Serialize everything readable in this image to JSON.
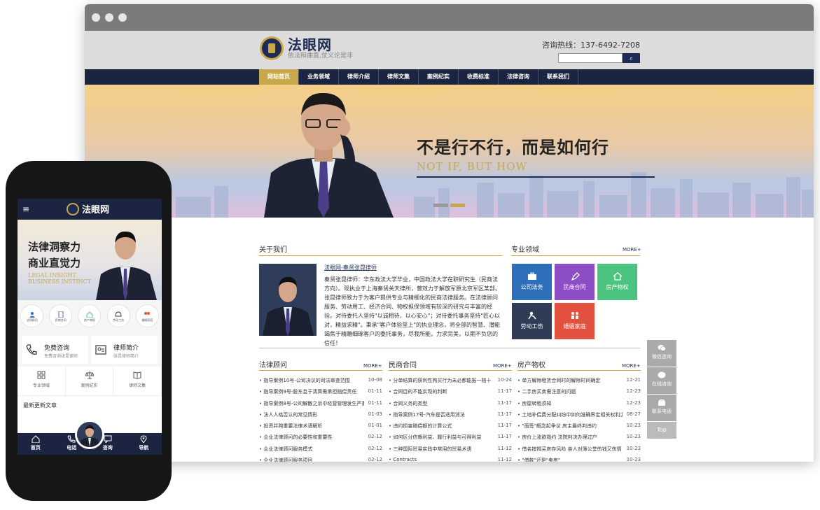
{
  "site": {
    "name": "法眼网",
    "slogan": "依法辩曲直,仗义论是非",
    "hotline": "咨询热线：137-6492-7208",
    "search_button": "⌕",
    "nav": [
      "网站首页",
      "业务领域",
      "律师介绍",
      "律师文集",
      "案例纪实",
      "收费标准",
      "法律咨询",
      "联系我们"
    ]
  },
  "banner": {
    "title": "不是行不行，而是如何行",
    "subtitle": "NOT IF, BUT HOW"
  },
  "about": {
    "title": "关于我们",
    "link": "法眼网-秦贤张昆律师",
    "text": "秦贤张昆律师：华东政法大学毕业，中国政法大学在职研究生（民商法方向）。现执业于上海秦贤关天律所，曾效力于解放军原北京军区某部。张昆律师致力于为客户提供专业与精细化的民商法律服务。在法律顾问服务、劳动用工、经济合同、物权担保领域有较深的研究与丰富的经验。对待委托人坚持\"以诚相待，以心安心\"；对待委托事务坚持\"匠心以对，精益求精\"。秉承\"客户体验至上\"的执业理念，将全部的智慧、潜能竭焦于精雕细琢客户的委托事务，尽我所能，力求完美，以期不负您的信任！"
  },
  "practice": {
    "title": "专业领域",
    "more": "MORE+",
    "tiles": [
      {
        "label": "公司法务",
        "color": "#2d6fb8"
      },
      {
        "label": "民商合同",
        "color": "#8d4dc4"
      },
      {
        "label": "房产物权",
        "color": "#4cc47f"
      },
      {
        "label": "劳动工伤",
        "color": "#2e3d55"
      },
      {
        "label": "婚姻家庭",
        "color": "#e2503f"
      }
    ]
  },
  "columns": [
    {
      "title": "法律顾问",
      "more": "MORE+",
      "items": [
        {
          "t": "指导案例10号-公司决议的司法审查范围",
          "d": "10-08"
        },
        {
          "t": "指导案例9号-股东怠于清算需承担赔偿责任",
          "d": "01-11"
        },
        {
          "t": "指导案例8号-公司解散之诉中经营管理发生严重困难",
          "d": "01-11"
        },
        {
          "t": "法人人格否认的常见情形",
          "d": "01-03"
        },
        {
          "t": "投资并购重要法律术语解析",
          "d": "01-01"
        },
        {
          "t": "企业法律顾问的必要性和重要性",
          "d": "02-12"
        },
        {
          "t": "企业法律顾问服务模式",
          "d": "02-12"
        },
        {
          "t": "企业法律顾问服务项目",
          "d": "02-12"
        }
      ]
    },
    {
      "title": "民商合同",
      "more": "MORE+",
      "items": [
        {
          "t": "分单结算的获利性购买行为未必都能报一赔十",
          "d": "10-24"
        },
        {
          "t": "合同目的不能实现的判断",
          "d": "11-17"
        },
        {
          "t": "合同义务的类型",
          "d": "11-17"
        },
        {
          "t": "指导案例17号-汽车是否适用消法",
          "d": "11-17"
        },
        {
          "t": "违约损害赔偿额的计算公式",
          "d": "11-17"
        },
        {
          "t": "如何区分信赖利益、履行利益与可得利益",
          "d": "11-17"
        },
        {
          "t": "三种国际贸易实践中常用的贸易术语",
          "d": "11-12"
        },
        {
          "t": "Contracts",
          "d": "11-12"
        }
      ]
    },
    {
      "title": "房产物权",
      "more": "MORE+",
      "items": [
        {
          "t": "单方解除租赁合同时的解除时间确定",
          "d": "12-21"
        },
        {
          "t": "二手房买卖需注意的问题",
          "d": "12-23"
        },
        {
          "t": "房屋转租须知",
          "d": "12-23"
        },
        {
          "t": "土地补偿费分配纠纷中如何准确界定相关权利主体",
          "d": "08-27"
        },
        {
          "t": "\"面签\"概念起争议 房主最终判违约",
          "d": "10-23"
        },
        {
          "t": "房价上涨欲毁约 法院判决办理过户",
          "d": "10-23"
        },
        {
          "t": "借名按揭买房存风险 亲人对簿公堂伤钱又伤情",
          "d": "10-23"
        },
        {
          "t": "\"借款\"还是\"卖房\"",
          "d": "10-23"
        }
      ]
    }
  ],
  "sidebar": [
    {
      "label": "微信咨询"
    },
    {
      "label": "在线咨询"
    },
    {
      "label": "联系电话"
    }
  ],
  "sidebar_top": "Top",
  "mobile": {
    "menu_icon": "≡",
    "logo": "法眼网",
    "banner_line1": "法律洞察力",
    "banner_line2": "商业直觉力",
    "banner_line3": "LEGAL INSIGHT",
    "banner_line4": "BUSINESS INSTINCT",
    "circles": [
      "法律顾问",
      "民商合同",
      "房产物权",
      "劳动工伤",
      "婚姻家庭"
    ],
    "cards": [
      {
        "h": "免费咨询",
        "s": "免费咨询张昆律师"
      },
      {
        "h": "律师简介",
        "s": "张昆律师简介"
      }
    ],
    "tools": [
      "专业领域",
      "案例纪实",
      "律师文集"
    ],
    "latest": "最新更新文章",
    "bar": [
      "首页",
      "电话",
      "咨询",
      "导航"
    ]
  }
}
